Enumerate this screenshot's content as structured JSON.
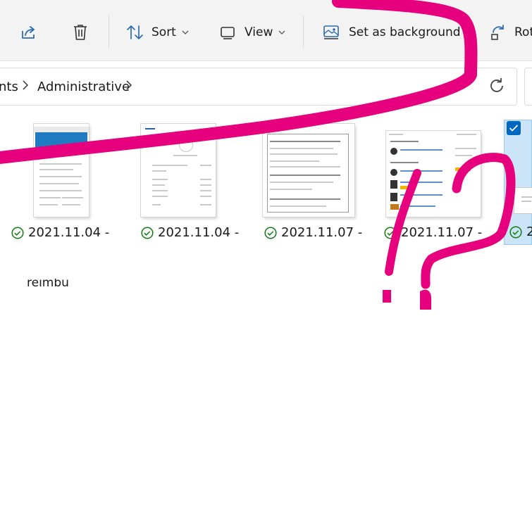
{
  "toolbar": {
    "sort_label": "Sort",
    "view_label": "View",
    "set_background_label": "Set as background",
    "rotate_label": "Rot"
  },
  "address": {
    "crumbs": [
      "nts",
      "Administrative"
    ]
  },
  "files": [
    {
      "name": "2021.11.04 -",
      "status": "synced"
    },
    {
      "name": "2021.11.04 -",
      "status": "synced"
    },
    {
      "name": "2021.11.07 -",
      "status": "synced"
    },
    {
      "name": "2021.11.07 -",
      "status": "synced"
    },
    {
      "name": "2",
      "status": "synced",
      "selected": true
    }
  ],
  "stray_text": "reimbu",
  "colors": {
    "annotation_ink": "#e6007e",
    "accent": "#0067c0",
    "synced_green": "#107c10"
  },
  "icons": [
    "share-icon",
    "delete-icon",
    "sort-icon",
    "view-icon",
    "set-background-icon",
    "rotate-icon",
    "chevron-right-icon",
    "chevron-down-icon",
    "refresh-icon",
    "synced-check-icon",
    "checkbox-checked-icon"
  ]
}
